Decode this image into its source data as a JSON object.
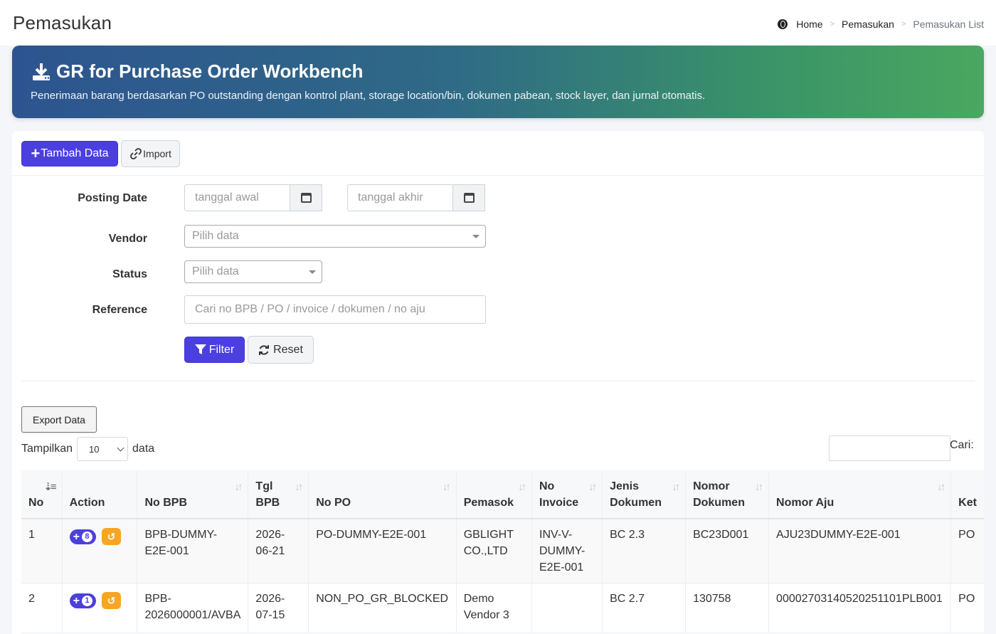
{
  "header": {
    "title": "Pemasukan",
    "breadcrumb": [
      "Home",
      "Pemasukan",
      "Pemasukan List"
    ]
  },
  "banner": {
    "title": "GR for Purchase Order Workbench",
    "subtitle": "Penerimaan barang berdasarkan PO outstanding dengan kontrol plant, storage location/bin, dokumen pabean, stock layer, dan jurnal otomatis."
  },
  "toolbar": {
    "add_label": "Tambah Data",
    "import_label": "Import"
  },
  "filters": {
    "posting_date_label": "Posting Date",
    "date_start_placeholder": "tanggal awal",
    "date_end_placeholder": "tanggal akhir",
    "vendor_label": "Vendor",
    "vendor_placeholder": "Pilih data",
    "status_label": "Status",
    "status_placeholder": "Pilih data",
    "reference_label": "Reference",
    "reference_placeholder": "Cari no BPB / PO / invoice / dokumen / no aju",
    "filter_label": "Filter",
    "reset_label": "Reset"
  },
  "datatable": {
    "export_label": "Export Data",
    "show_label": "Tampilkan",
    "page_size": "10",
    "data_label": "data",
    "search_label": "Cari:",
    "columns": [
      "No",
      "Action",
      "No BPB",
      "Tgl BPB",
      "No PO",
      "Pemasok",
      "No Invoice",
      "Jenis Dokumen",
      "Nomor Dokumen",
      "Nomor Aju",
      "Ket"
    ],
    "rows": [
      {
        "no": "1",
        "badge_count": "8",
        "no_bpb": "BPB-DUMMY-E2E-001",
        "tgl_bpb": "2026-06-21",
        "no_po": "PO-DUMMY-E2E-001",
        "pemasok": "GBLIGHT CO.,LTD",
        "no_invoice": "INV-V-DUMMY-E2E-001",
        "jenis_dokumen": "BC 2.3",
        "nomor_dokumen": "BC23D001",
        "nomor_aju": "AJU23DUMMY-E2E-001",
        "ket": "PO"
      },
      {
        "no": "2",
        "badge_count": "1",
        "no_bpb": "BPB-2026000001/AVBA",
        "tgl_bpb": "2026-07-15",
        "no_po": "NON_PO_GR_BLOCKED",
        "pemasok": "Demo Vendor 3",
        "no_invoice": "",
        "jenis_dokumen": "BC 2.7",
        "nomor_dokumen": "130758",
        "nomor_aju": "00002703140520251101PLB001",
        "ket": "PO"
      }
    ]
  }
}
